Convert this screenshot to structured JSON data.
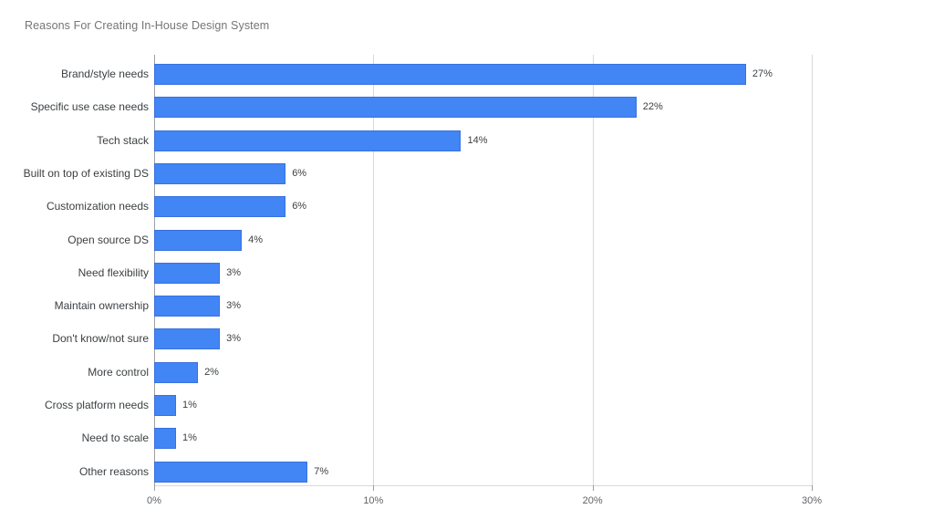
{
  "chart_data": {
    "type": "bar",
    "orientation": "horizontal",
    "title": "Reasons For Creating In-House Design System",
    "xlabel": "",
    "ylabel": "",
    "xlim": [
      0,
      30
    ],
    "grid": true,
    "legend": false,
    "bar_color": "#4285f4",
    "bar_border_color": "#3971e0",
    "title_color": "#757575",
    "label_color": "#3c4043",
    "tick_color": "#5f6368",
    "gridline_color": "#d9d9d9",
    "axis_color": "#9e9e9e",
    "value_suffix": "%",
    "xticks": [
      0,
      10,
      20,
      30
    ],
    "xtick_labels": [
      "0%",
      "10%",
      "20%",
      "30%"
    ],
    "categories": [
      "Brand/style needs",
      "Specific use case needs",
      "Tech stack",
      "Built on top of existing DS",
      "Customization needs",
      "Open source DS",
      "Need flexibility",
      "Maintain ownership",
      "Don't know/not sure",
      "More control",
      "Cross platform needs",
      "Need to scale",
      "Other reasons"
    ],
    "values": [
      27,
      22,
      14,
      6,
      6,
      4,
      3,
      3,
      3,
      2,
      1,
      1,
      7
    ],
    "value_labels": [
      "27%",
      "22%",
      "14%",
      "6%",
      "6%",
      "4%",
      "3%",
      "3%",
      "3%",
      "2%",
      "1%",
      "1%",
      "7%"
    ]
  }
}
